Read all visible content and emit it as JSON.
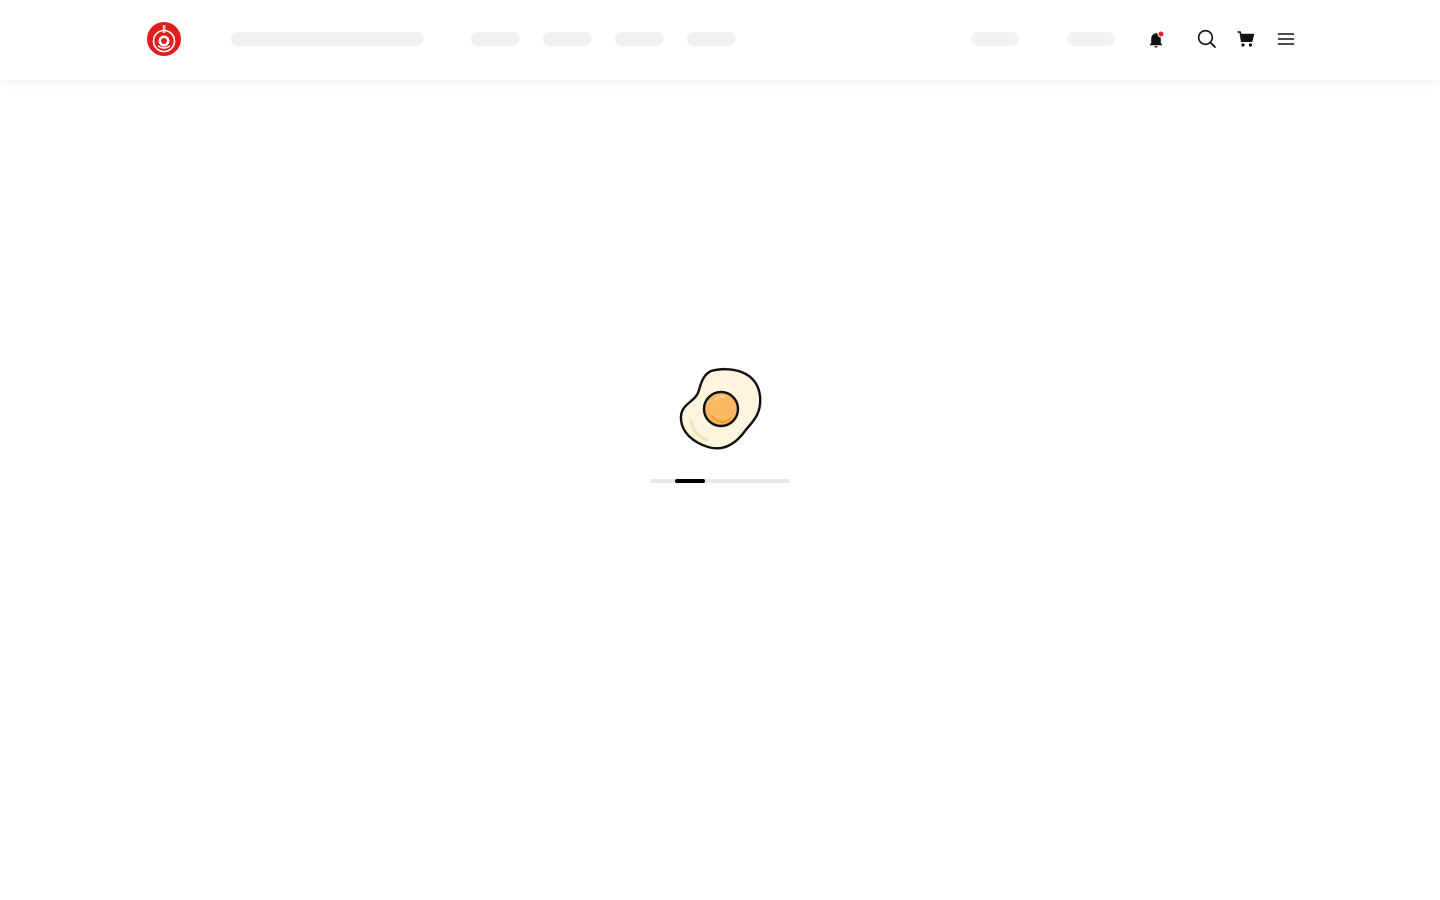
{
  "header": {
    "logo_icon": "restaurant-logo-icon",
    "icons": {
      "notifications": "bell-icon",
      "search": "search-icon",
      "cart": "cart-icon",
      "menu": "hamburger-menu-icon"
    },
    "notification_dot_color": "#f5222d",
    "brand_color": "#e11d1d"
  },
  "loading": {
    "illustration": "fried-egg-icon",
    "progress_fraction": 0.21
  }
}
